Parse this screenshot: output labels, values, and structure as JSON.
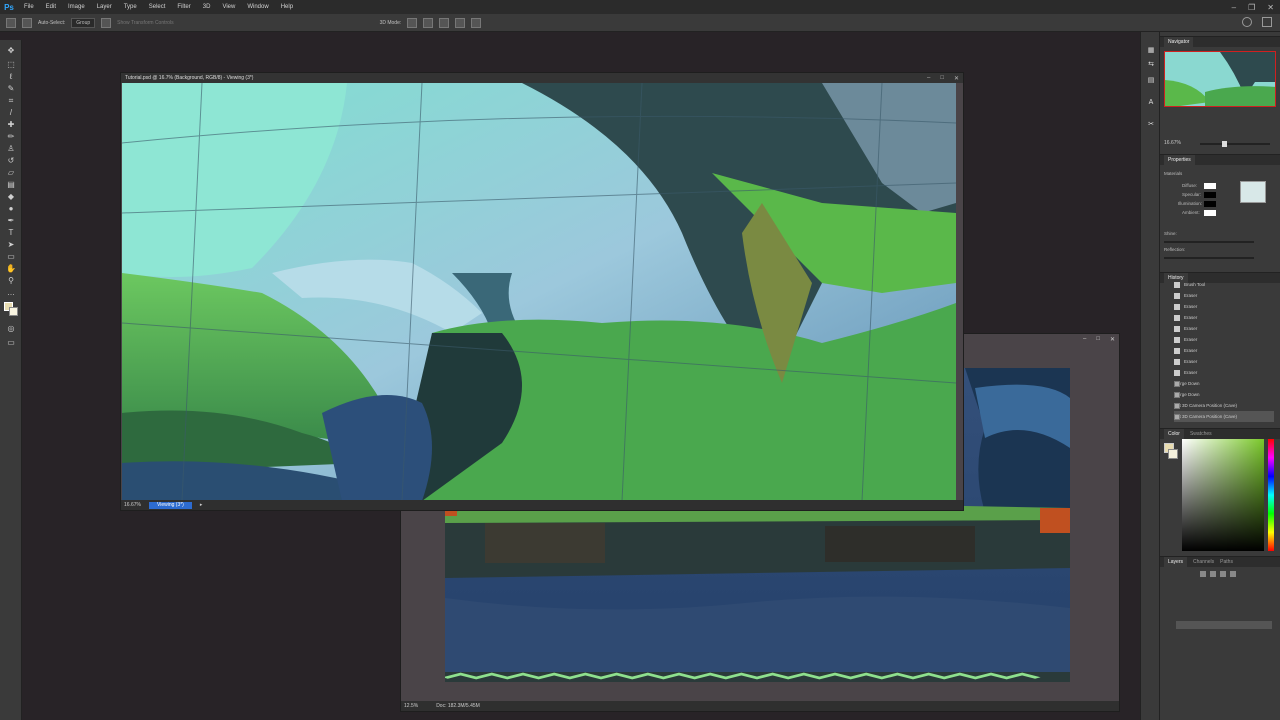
{
  "app": {
    "logo": "Ps",
    "menu": [
      "File",
      "Edit",
      "Image",
      "Layer",
      "Type",
      "Select",
      "Filter",
      "3D",
      "View",
      "Window",
      "Help"
    ],
    "window_controls": [
      "–",
      "❐",
      "✕"
    ]
  },
  "options_bar": {
    "auto_select": "Auto-Select:",
    "auto_select_value": "Group",
    "show_transform": "Show Transform Controls",
    "mode_3d": "3D Mode:"
  },
  "documents": {
    "main": {
      "title": "Tutorial.psd @ 16.7% (Background, RGB/8) - Viewing (3*)",
      "zoom": "16.67%",
      "status_tab": "Viewing (3*)"
    },
    "second": {
      "zoom": "12.5%",
      "doc_info": "Doc: 182.3M/5.45M"
    }
  },
  "panels": {
    "navigator": {
      "tab": "Navigator",
      "zoom": "16.67%"
    },
    "properties": {
      "tab": "Properties",
      "section": "Materials",
      "rows": [
        "Diffuse:",
        "Specular:",
        "Illumination:",
        "Ambient:"
      ],
      "shine_label": "Shine:",
      "reflection_label": "Reflection:"
    },
    "history": {
      "tab": "History",
      "items": [
        "Brush Tool",
        "Eraser",
        "Eraser",
        "Eraser",
        "Eraser",
        "Eraser",
        "Eraser",
        "Eraser",
        "Eraser",
        "Merge Down",
        "Merge Down",
        "Set 3D Camera Position (Cave)",
        "Set 3D Camera Position (Cave)"
      ]
    },
    "color": {
      "tab": "Color",
      "tab2": "Swatches"
    },
    "layers": {
      "tab": "Layers",
      "tab2": "Channels",
      "tab3": "Paths"
    }
  }
}
